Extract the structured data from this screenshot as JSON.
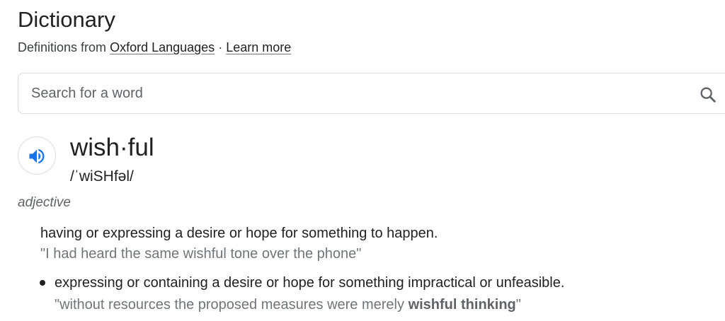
{
  "header": {
    "title": "Dictionary",
    "source_prefix": "Definitions from",
    "source_link": "Oxford Languages",
    "separator": "·",
    "learn_more": "Learn more"
  },
  "search": {
    "placeholder": "Search for a word",
    "value": "",
    "icon": "search-icon"
  },
  "entry": {
    "speaker_icon": "speaker-icon",
    "word": "wish·ful",
    "phonetic": "/ˈwiSHfəl/",
    "part_of_speech": "adjective",
    "senses": [
      {
        "definition": "having or expressing a desire or hope for something to happen.",
        "example": "\"I had heard the same wishful tone over the phone\""
      },
      {
        "definition": "expressing or containing a desire or hope for something impractical or unfeasible.",
        "example_before": "\"without resources the proposed measures were merely ",
        "example_bold": "wishful thinking",
        "example_after": "\""
      }
    ]
  },
  "colors": {
    "text": "#202124",
    "secondary_text": "#5f6368",
    "example_text": "#70757a",
    "border": "#dadce0",
    "accent_blue": "#1a73e8"
  }
}
